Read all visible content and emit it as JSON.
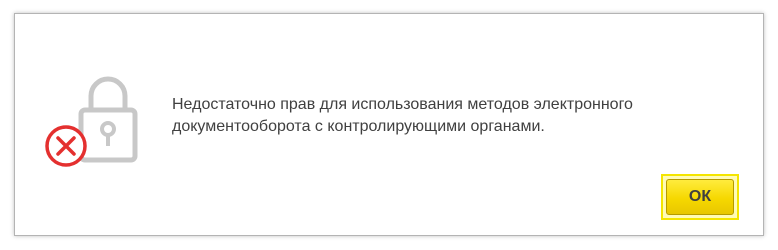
{
  "dialog": {
    "message": "Недостаточно прав для использования методов электронного документооборота с контролирующими органами.",
    "icon": "lock-with-error-icon",
    "ok_label": "ОК"
  },
  "colors": {
    "lock": "#c8c8c8",
    "error": "#e4302f",
    "button": "#f6d800",
    "text": "#404040"
  }
}
